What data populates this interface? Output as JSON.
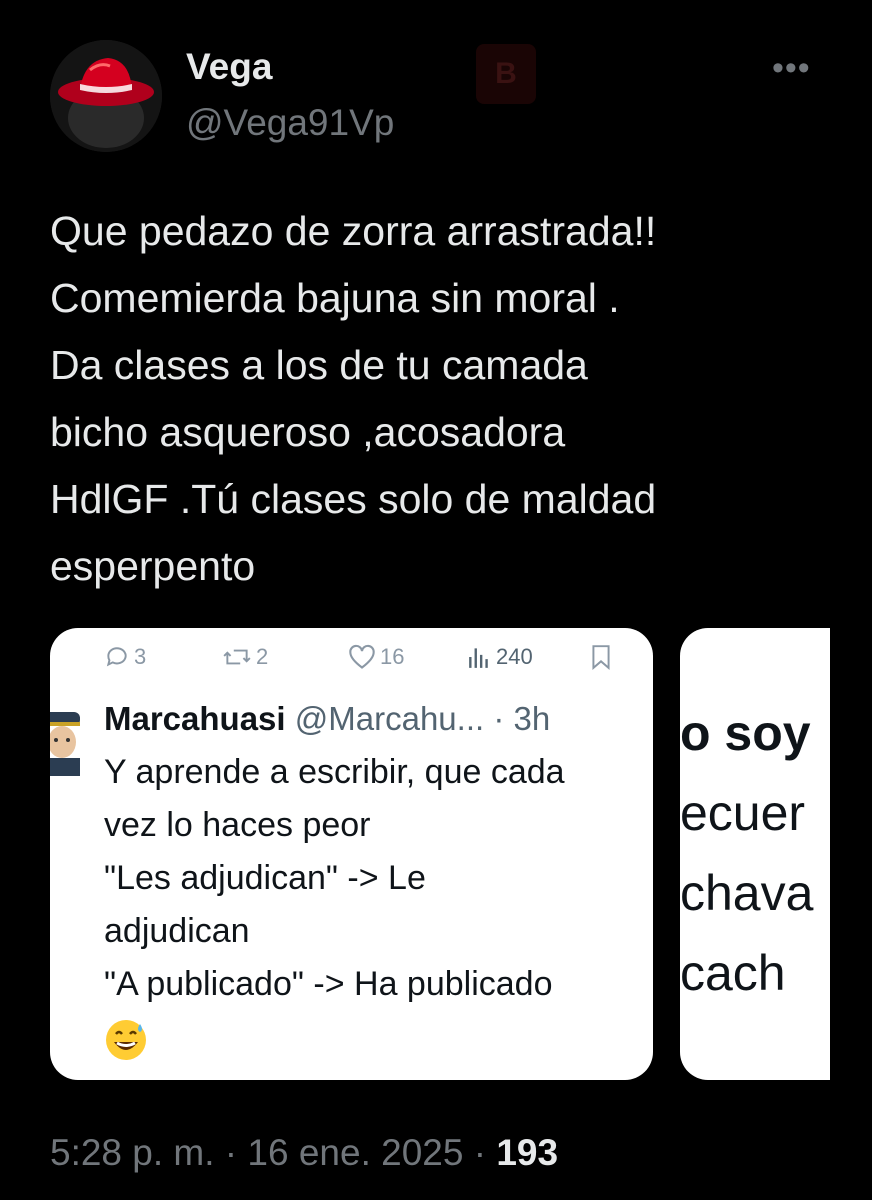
{
  "author": {
    "name": "Vega",
    "handle": "@Vega91Vp"
  },
  "body_lines": [
    "Que pedazo de zorra arrastrada!!",
    "Comemierda bajuna sin moral .",
    "Da clases a los de tu camada",
    "bicho asqueroso ,acosadora",
    "HdlGF .Tú clases solo de maldad",
    "esperpento"
  ],
  "embedded": {
    "stats": {
      "replies": "3",
      "reposts": "2",
      "likes": "16",
      "views": "240"
    },
    "reply": {
      "name": "Marcahuasi",
      "handle_time": "@Marcahu... · 3h",
      "lines": [
        "Y aprende a escribir, que cada",
        "vez lo haces peor",
        "\"Les adjudican\" -> Le",
        "adjudican",
        "\"A publicado\" -> Ha publicado"
      ],
      "emoji_icon": "grinning-face-with-sweat-emoji"
    },
    "second_card_lines": [
      "o soy",
      "ecuer",
      "chava",
      "cach"
    ]
  },
  "footer": {
    "meta": "5:28 p. m. · 16 ene. 2025 · ",
    "views": "193"
  },
  "colors": {
    "background": "#000000",
    "text": "#e7e9ea",
    "muted": "#71767b"
  }
}
